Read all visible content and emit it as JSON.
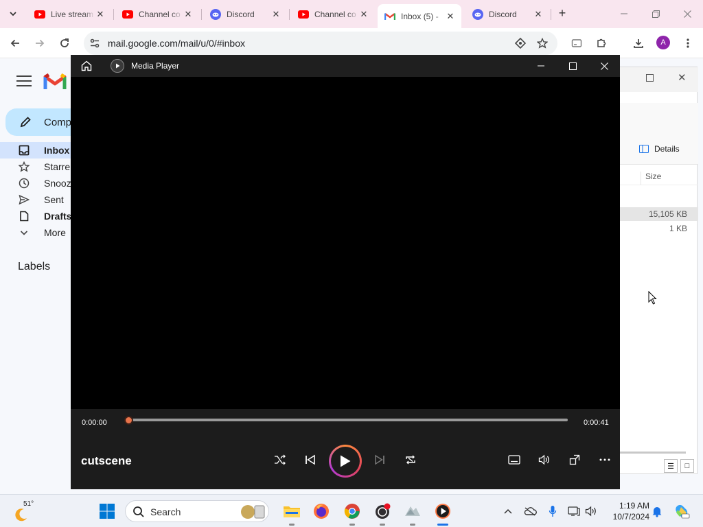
{
  "browser": {
    "tabs": [
      {
        "title": "Live stream",
        "favicon": "youtube-icon",
        "active": false
      },
      {
        "title": "Channel co",
        "favicon": "youtube-icon",
        "active": false
      },
      {
        "title": "Discord",
        "favicon": "discord-icon",
        "active": false
      },
      {
        "title": "Channel co",
        "favicon": "youtube-icon",
        "active": false
      },
      {
        "title": "Inbox (5) -",
        "favicon": "gmail-icon",
        "active": true
      },
      {
        "title": "Discord",
        "favicon": "discord-icon",
        "active": false
      }
    ],
    "url": "mail.google.com/mail/u/0/#inbox",
    "profile_initial": "A"
  },
  "gmail": {
    "compose_label": "Comp",
    "nav": [
      {
        "label": "Inbox",
        "icon": "inbox-icon",
        "bold": true,
        "active": true
      },
      {
        "label": "Starre",
        "icon": "star-icon",
        "bold": false,
        "active": false
      },
      {
        "label": "Snooz",
        "icon": "clock-icon",
        "bold": false,
        "active": false
      },
      {
        "label": "Sent",
        "icon": "send-icon",
        "bold": false,
        "active": false
      },
      {
        "label": "Drafts",
        "icon": "draft-icon",
        "bold": true,
        "active": false
      },
      {
        "label": "More",
        "icon": "chevron-down-icon",
        "bold": false,
        "active": false
      }
    ],
    "labels_heading": "Labels"
  },
  "explorer": {
    "details_label": "Details",
    "size_header": "Size",
    "rows": [
      "15,105 KB",
      "1 KB"
    ]
  },
  "player": {
    "app_title": "Media Player",
    "elapsed": "0:00:00",
    "duration": "0:00:41",
    "progress": 0,
    "media_title": "cutscene",
    "accent_color": "#e8734a"
  },
  "taskbar": {
    "weather_temp": "51°",
    "search_label": "Search",
    "time": "1:19 AM",
    "date": "10/7/2024"
  }
}
